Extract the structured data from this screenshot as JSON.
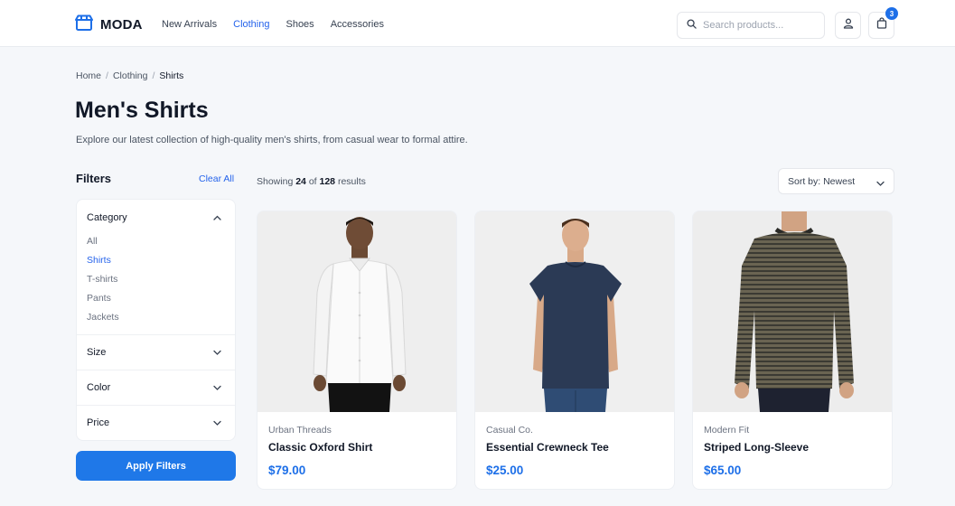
{
  "header": {
    "logo_text": "MODA",
    "nav": [
      {
        "label": "New Arrivals",
        "active": false
      },
      {
        "label": "Clothing",
        "active": true
      },
      {
        "label": "Shoes",
        "active": false
      },
      {
        "label": "Accessories",
        "active": false
      }
    ],
    "search_placeholder": "Search products...",
    "cart_count": "3"
  },
  "breadcrumb": {
    "items": [
      "Home",
      "Clothing"
    ],
    "separator": "/",
    "current": "Shirts"
  },
  "page": {
    "title": "Men's Shirts",
    "subtitle": "Explore our latest collection of high-quality men's shirts, from casual wear to formal attire."
  },
  "filters": {
    "title": "Filters",
    "clear_label": "Clear All",
    "category": {
      "label": "Category",
      "items": [
        {
          "label": "All",
          "active": false
        },
        {
          "label": "Shirts",
          "active": true
        },
        {
          "label": "T-shirts",
          "active": false
        },
        {
          "label": "Pants",
          "active": false
        },
        {
          "label": "Jackets",
          "active": false
        }
      ]
    },
    "size_label": "Size",
    "color_label": "Color",
    "price_label": "Price",
    "apply_label": "Apply Filters"
  },
  "results": {
    "prefix": "Showing",
    "shown": "24",
    "of": "of",
    "total": "128",
    "suffix": "results"
  },
  "sort": {
    "label": "Sort by: Newest"
  },
  "products": [
    {
      "brand": "Urban Threads",
      "name": "Classic Oxford Shirt",
      "price": "$79.00",
      "garment": "oxford-shirt"
    },
    {
      "brand": "Casual Co.",
      "name": "Essential Crewneck Tee",
      "price": "$25.00",
      "garment": "crewneck-tee"
    },
    {
      "brand": "Modern Fit",
      "name": "Striped Long-Sleeve",
      "price": "$65.00",
      "garment": "striped-long-sleeve"
    }
  ],
  "colors": {
    "accent": "#2563eb",
    "button": "#1f78e8",
    "price": "#1d6fe8",
    "background": "#f5f7fa"
  },
  "icons": {
    "logo": "store-icon",
    "search": "search-icon",
    "account": "user-icon",
    "cart": "shopping-bag-icon"
  }
}
